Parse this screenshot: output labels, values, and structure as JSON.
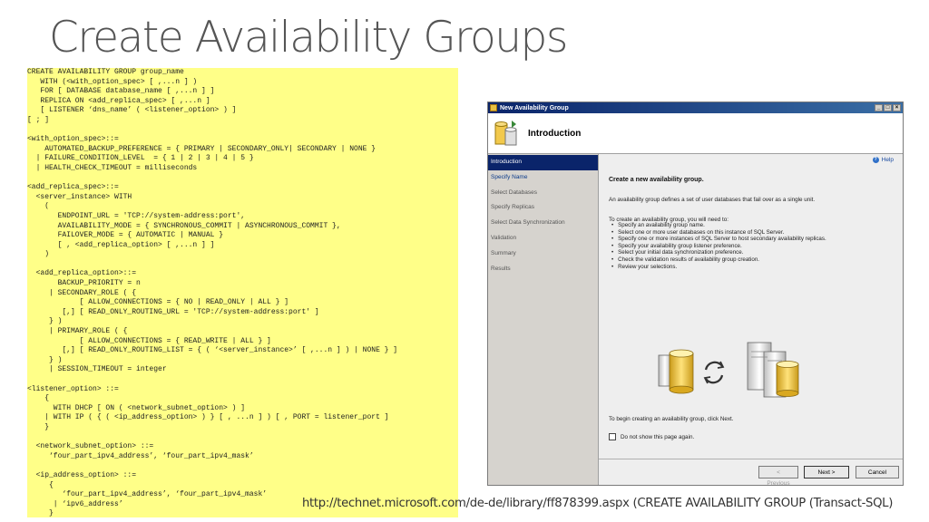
{
  "slide": {
    "title": "Create Availability Groups",
    "source": "http://technet.microsoft.com/de-de/library/ff878399.aspx  (CREATE AVAILABILITY GROUP (Transact-SQL)"
  },
  "code_lines": [
    "CREATE AVAILABILITY GROUP group_name",
    "   WITH (<with_option_spec> [ ,...n ] )",
    "   FOR [ DATABASE database_name [ ,...n ] ]",
    "   REPLICA ON <add_replica_spec> [ ,...n ]",
    "   [ LISTENER ‘dns_name’ ( <listener_option> ) ]",
    "[ ; ]",
    "",
    "<with_option_spec>::=",
    "    AUTOMATED_BACKUP_PREFERENCE = { PRIMARY | SECONDARY_ONLY| SECONDARY | NONE }",
    "  | FAILURE_CONDITION_LEVEL  = { 1 | 2 | 3 | 4 | 5 }",
    "  | HEALTH_CHECK_TIMEOUT = milliseconds",
    "",
    "<add_replica_spec>::=",
    "  <server_instance> WITH",
    "    (",
    "       ENDPOINT_URL = 'TCP://system-address:port',",
    "       AVAILABILITY_MODE = { SYNCHRONOUS_COMMIT | ASYNCHRONOUS_COMMIT },",
    "       FAILOVER_MODE = { AUTOMATIC | MANUAL }",
    "       [ , <add_replica_option> [ ,...n ] ]",
    "    )",
    "",
    "  <add_replica_option>::=",
    "       BACKUP_PRIORITY = n",
    "     | SECONDARY_ROLE ( {",
    "            [ ALLOW_CONNECTIONS = { NO | READ_ONLY | ALL } ]",
    "        [,] [ READ_ONLY_ROUTING_URL = 'TCP://system-address:port' ]",
    "     } )",
    "     | PRIMARY_ROLE ( {",
    "            [ ALLOW_CONNECTIONS = { READ_WRITE | ALL } ]",
    "        [,] [ READ_ONLY_ROUTING_LIST = { ( ‘<server_instance>’ [ ,...n ] ) | NONE } ]",
    "     } )",
    "     | SESSION_TIMEOUT = integer",
    "",
    "<listener_option> ::=",
    "    {",
    "      WITH DHCP [ ON ( <network_subnet_option> ) ]",
    "    | WITH IP ( { ( <ip_address_option> ) } [ , ...n ] ) [ , PORT = listener_port ]",
    "    }",
    "",
    "  <network_subnet_option> ::=",
    "     ‘four_part_ipv4_address’, ‘four_part_ipv4_mask’",
    "",
    "  <ip_address_option> ::=",
    "     {",
    "        ‘four_part_ipv4_address’, ‘four_part_ipv4_mask’",
    "      | ‘ipv6_address’",
    "     }"
  ],
  "dialog": {
    "window_title": "New Availability Group",
    "header_title": "Introduction",
    "nav_items": [
      "Introduction",
      "Specify Name",
      "Select Databases",
      "Specify Replicas",
      "Select Data Synchronization",
      "Validation",
      "Summary",
      "Results"
    ],
    "help_label": "Help",
    "heading": "Create a new availability group.",
    "description": "An availability group defines a set of user databases that fail over as a single unit.",
    "intro": "To create an availability group, you will need to:",
    "steps": [
      "Specify an availability group name.",
      "Select one or more user databases on this instance of SQL Server.",
      "Specify one or more instances of SQL Server to host secondary availability replicas.",
      "Specify your availability group listener preference.",
      "Select your initial data synchronization preference.",
      "Check the validation results of availability group creation.",
      "Review your selections."
    ],
    "next_hint": "To begin creating an availability group, click Next.",
    "checkbox_label": "Do not show this page again.",
    "buttons": {
      "previous": "< Previous",
      "next": "Next >",
      "cancel": "Cancel"
    }
  }
}
